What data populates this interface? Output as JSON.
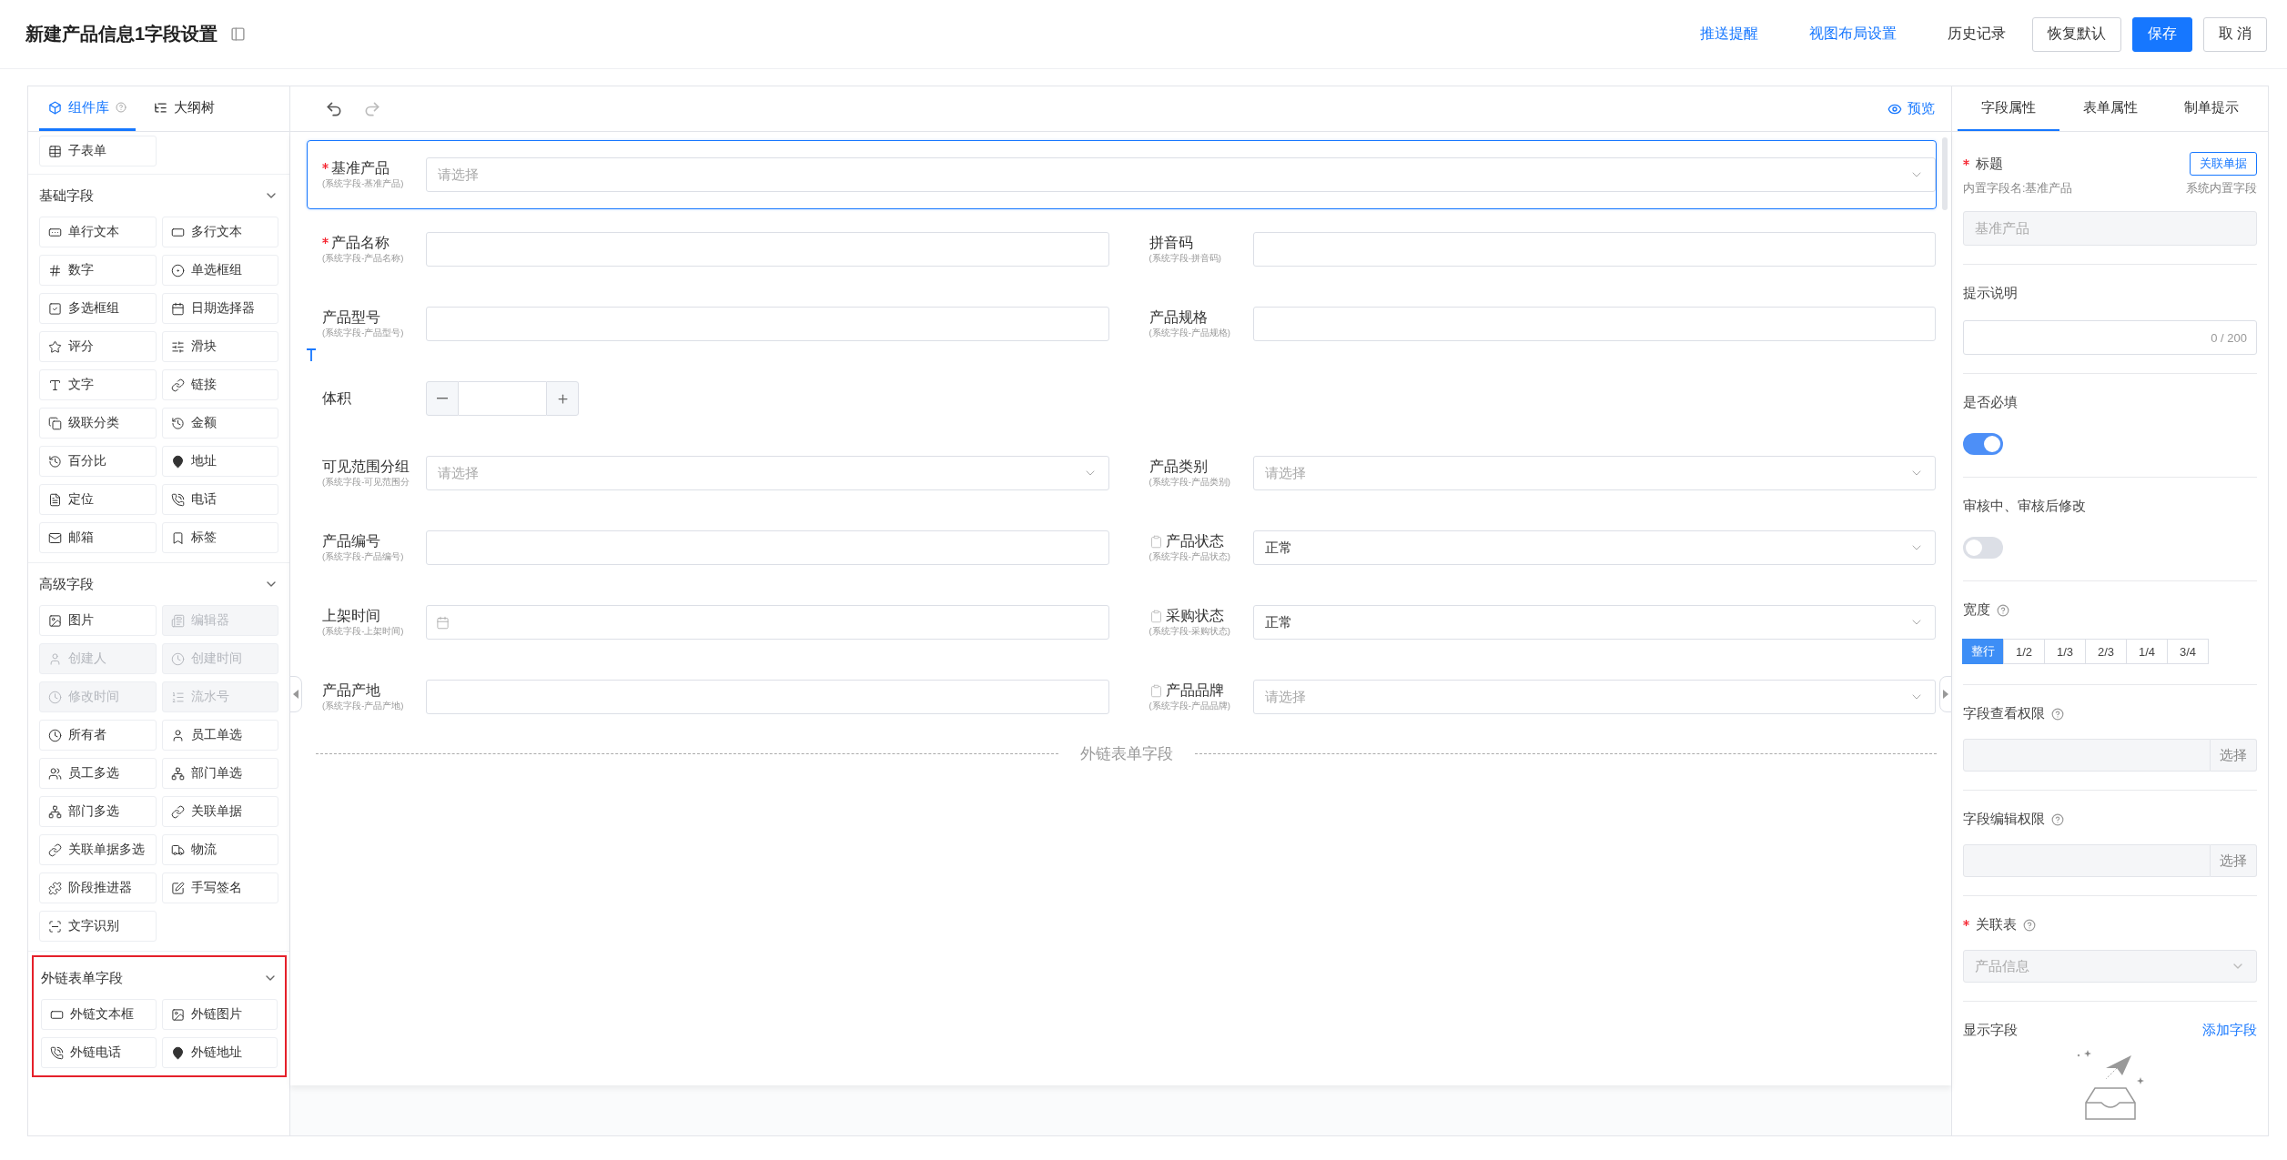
{
  "header": {
    "title": "新建产品信息1字段设置",
    "actions": [
      {
        "kind": "link",
        "label": "推送提醒"
      },
      {
        "kind": "link",
        "label": "视图布局设置"
      },
      {
        "kind": "text",
        "label": "历史记录"
      },
      {
        "kind": "outline",
        "label": "恢复默认"
      },
      {
        "kind": "primary",
        "label": "保存"
      },
      {
        "kind": "outline",
        "label": "取 消"
      }
    ]
  },
  "left_panel": {
    "tabs": [
      {
        "label": "组件库",
        "selected": true,
        "help": true
      },
      {
        "label": "大纲树",
        "selected": false,
        "help": false
      }
    ],
    "top_items": [
      {
        "label": "子表单",
        "disabled": false
      }
    ],
    "sections": [
      {
        "title": "基础字段",
        "expanded": true,
        "highlighted": false,
        "items": [
          {
            "label": "单行文本",
            "disabled": false
          },
          {
            "label": "多行文本",
            "disabled": false
          },
          {
            "label": "数字",
            "disabled": false
          },
          {
            "label": "单选框组",
            "disabled": false
          },
          {
            "label": "多选框组",
            "disabled": false
          },
          {
            "label": "日期选择器",
            "disabled": false
          },
          {
            "label": "评分",
            "disabled": false
          },
          {
            "label": "滑块",
            "disabled": false
          },
          {
            "label": "文字",
            "disabled": false
          },
          {
            "label": "链接",
            "disabled": false
          },
          {
            "label": "级联分类",
            "disabled": false
          },
          {
            "label": "金额",
            "disabled": false
          },
          {
            "label": "百分比",
            "disabled": false
          },
          {
            "label": "地址",
            "disabled": false
          },
          {
            "label": "定位",
            "disabled": false
          },
          {
            "label": "电话",
            "disabled": false
          },
          {
            "label": "邮箱",
            "disabled": false
          },
          {
            "label": "标签",
            "disabled": false
          }
        ]
      },
      {
        "title": "高级字段",
        "expanded": true,
        "highlighted": false,
        "items": [
          {
            "label": "图片",
            "disabled": false
          },
          {
            "label": "编辑器",
            "disabled": true
          },
          {
            "label": "创建人",
            "disabled": true
          },
          {
            "label": "创建时间",
            "disabled": true
          },
          {
            "label": "修改时间",
            "disabled": true
          },
          {
            "label": "流水号",
            "disabled": true
          },
          {
            "label": "所有者",
            "disabled": false
          },
          {
            "label": "员工单选",
            "disabled": false
          },
          {
            "label": "员工多选",
            "disabled": false
          },
          {
            "label": "部门单选",
            "disabled": false
          },
          {
            "label": "部门多选",
            "disabled": false
          },
          {
            "label": "关联单据",
            "disabled": false
          },
          {
            "label": "关联单据多选",
            "disabled": false
          },
          {
            "label": "物流",
            "disabled": false
          },
          {
            "label": "阶段推进器",
            "disabled": false
          },
          {
            "label": "手写签名",
            "disabled": false
          },
          {
            "label": "文字识别",
            "disabled": false
          }
        ]
      },
      {
        "title": "外链表单字段",
        "expanded": true,
        "highlighted": true,
        "items": [
          {
            "label": "外链文本框",
            "disabled": false
          },
          {
            "label": "外链图片",
            "disabled": false
          },
          {
            "label": "外链电话",
            "disabled": false
          },
          {
            "label": "外链地址",
            "disabled": false
          }
        ]
      }
    ]
  },
  "canvas": {
    "preview": "预览",
    "rows": [
      {
        "fields": [
          {
            "kind": "select",
            "label": "基准产品",
            "sublabel": "(系统字段-基准产品)",
            "required": true,
            "locked": false,
            "placeholder": "请选择",
            "selected": true
          }
        ]
      },
      {
        "fields": [
          {
            "kind": "text",
            "label": "产品名称",
            "sublabel": "(系统字段-产品名称)",
            "required": true,
            "locked": false,
            "selected": false
          },
          {
            "kind": "text",
            "label": "拼音码",
            "sublabel": "(系统字段-拼音码)",
            "required": false,
            "locked": false,
            "selected": false
          }
        ]
      },
      {
        "fields": [
          {
            "kind": "text",
            "label": "产品型号",
            "sublabel": "(系统字段-产品型号)",
            "required": false,
            "locked": false,
            "selected": false
          },
          {
            "kind": "text",
            "label": "产品规格",
            "sublabel": "(系统字段-产品规格)",
            "required": false,
            "locked": false,
            "selected": false
          }
        ]
      },
      {
        "fields": [
          {
            "kind": "number",
            "label": "体积",
            "required": false,
            "locked": false,
            "selected": false
          },
          {
            "kind": "empty"
          }
        ]
      },
      {
        "fields": [
          {
            "kind": "select",
            "label": "可见范围分组",
            "sublabel": "(系统字段-可见范围分",
            "required": false,
            "locked": false,
            "placeholder": "请选择",
            "selected": false
          },
          {
            "kind": "select",
            "label": "产品类别",
            "sublabel": "(系统字段-产品类别)",
            "required": false,
            "locked": false,
            "placeholder": "请选择",
            "selected": false
          }
        ]
      },
      {
        "fields": [
          {
            "kind": "text",
            "label": "产品编号",
            "sublabel": "(系统字段-产品编号)",
            "required": false,
            "locked": false,
            "selected": false
          },
          {
            "kind": "select",
            "label": "产品状态",
            "sublabel": "(系统字段-产品状态)",
            "required": false,
            "locked": true,
            "value": "正常",
            "selected": false
          }
        ]
      },
      {
        "fields": [
          {
            "kind": "date",
            "label": "上架时间",
            "sublabel": "(系统字段-上架时间)",
            "required": false,
            "locked": false,
            "selected": false
          },
          {
            "kind": "select",
            "label": "采购状态",
            "sublabel": "(系统字段-采购状态)",
            "required": false,
            "locked": true,
            "value": "正常",
            "selected": false
          }
        ]
      },
      {
        "fields": [
          {
            "kind": "text",
            "label": "产品产地",
            "sublabel": "(系统字段-产品产地)",
            "required": false,
            "locked": false,
            "selected": false
          },
          {
            "kind": "select",
            "label": "产品品牌",
            "sublabel": "(系统字段-产品品牌)",
            "required": false,
            "locked": true,
            "placeholder": "请选择",
            "selected": false
          }
        ]
      }
    ],
    "divider": "外链表单字段"
  },
  "properties": {
    "tabs": [
      {
        "label": "字段属性",
        "selected": true
      },
      {
        "label": "表单属性",
        "selected": false
      },
      {
        "label": "制单提示",
        "selected": false
      }
    ],
    "sections": [
      {
        "kind": "title",
        "label": "标题",
        "required": true,
        "button": "关联单据",
        "field_name": "内置字段名:基准产品",
        "field_type": "系统内置字段",
        "value": "基准产品"
      },
      {
        "kind": "counter_input",
        "label": "提示说明",
        "counter": "0 / 200"
      },
      {
        "kind": "switch",
        "label": "是否必填",
        "on": true
      },
      {
        "kind": "switch",
        "label": "审核中、审核后修改",
        "on": false
      },
      {
        "kind": "segmented",
        "label": "宽度",
        "help": true,
        "options": [
          {
            "label": "整行",
            "selected": true
          },
          {
            "label": "1/2",
            "selected": false
          },
          {
            "label": "1/3",
            "selected": false
          },
          {
            "label": "2/3",
            "selected": false
          },
          {
            "label": "1/4",
            "selected": false
          },
          {
            "label": "3/4",
            "selected": false
          }
        ]
      },
      {
        "kind": "picker",
        "label": "字段查看权限",
        "help": true,
        "button": "选择"
      },
      {
        "kind": "picker",
        "label": "字段编辑权限",
        "help": true,
        "button": "选择"
      },
      {
        "kind": "select",
        "label": "关联表",
        "help": true,
        "required": true,
        "value": "产品信息"
      },
      {
        "kind": "empty_list",
        "label": "显示字段",
        "link": "添加字段"
      }
    ]
  }
}
